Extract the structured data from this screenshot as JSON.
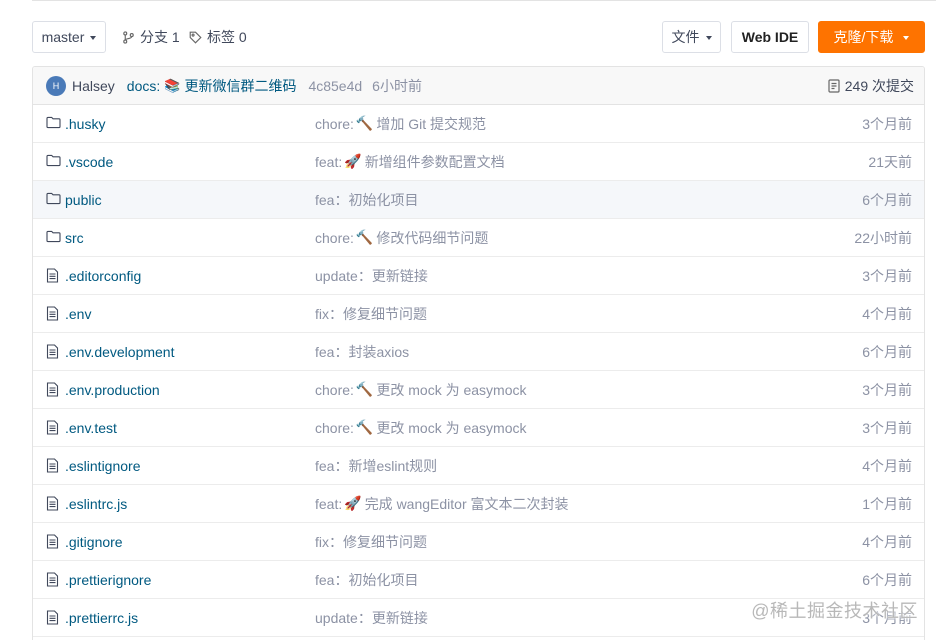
{
  "toolbar": {
    "branch_selector": "master",
    "branches_label": "分支 1",
    "tags_label": "标签 0",
    "file_menu": "文件",
    "web_ide": "Web IDE",
    "clone_download": "克隆/下载",
    "accent_color": "#fe7300"
  },
  "commit": {
    "avatar_initial": "H",
    "author": "Halsey",
    "prefix": "docs:",
    "emoji": "📚",
    "message": "更新微信群二维码",
    "sha": "4c85e4d",
    "time": "6小时前",
    "count_label": "249 次提交"
  },
  "files": [
    {
      "type": "folder",
      "name": ".husky",
      "prefix": "chore:",
      "emoji": "🔨",
      "message": "增加 Git 提交规范",
      "time": "3个月前"
    },
    {
      "type": "folder",
      "name": ".vscode",
      "prefix": "feat:",
      "emoji": "🚀",
      "message": "新增组件参数配置文档",
      "time": "21天前"
    },
    {
      "type": "folder",
      "name": "public",
      "prefix": "fea：",
      "emoji": "",
      "message": "初始化项目",
      "time": "6个月前"
    },
    {
      "type": "folder",
      "name": "src",
      "prefix": "chore:",
      "emoji": "🔨",
      "message": "修改代码细节问题",
      "time": "22小时前"
    },
    {
      "type": "file",
      "name": ".editorconfig",
      "prefix": "update：",
      "emoji": "",
      "message": "更新链接",
      "time": "3个月前"
    },
    {
      "type": "file",
      "name": ".env",
      "prefix": "fix：",
      "emoji": "",
      "message": "修复细节问题",
      "time": "4个月前"
    },
    {
      "type": "file",
      "name": ".env.development",
      "prefix": "fea：",
      "emoji": "",
      "message": "封装axios",
      "time": "6个月前"
    },
    {
      "type": "file",
      "name": ".env.production",
      "prefix": "chore:",
      "emoji": "🔨",
      "message": "更改 mock 为 easymock",
      "time": "3个月前"
    },
    {
      "type": "file",
      "name": ".env.test",
      "prefix": "chore:",
      "emoji": "🔨",
      "message": "更改 mock 为 easymock",
      "time": "3个月前"
    },
    {
      "type": "file",
      "name": ".eslintignore",
      "prefix": "fea：",
      "emoji": "",
      "message": "新增eslint规则",
      "time": "4个月前"
    },
    {
      "type": "file",
      "name": ".eslintrc.js",
      "prefix": "feat:",
      "emoji": "🚀",
      "message": "完成 wangEditor 富文本二次封装",
      "time": "1个月前"
    },
    {
      "type": "file",
      "name": ".gitignore",
      "prefix": "fix：",
      "emoji": "",
      "message": "修复细节问题",
      "time": "4个月前"
    },
    {
      "type": "file",
      "name": ".prettierignore",
      "prefix": "fea：",
      "emoji": "",
      "message": "初始化项目",
      "time": "6个月前"
    },
    {
      "type": "file",
      "name": ".prettierrc.js",
      "prefix": "update：",
      "emoji": "",
      "message": "更新链接",
      "time": "3个月前"
    }
  ],
  "watermark": "@稀土掘金技术社区"
}
